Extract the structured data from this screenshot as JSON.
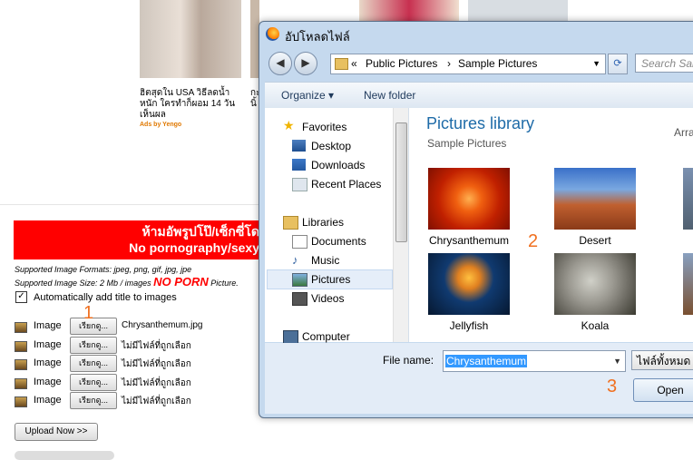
{
  "page": {
    "ads": [
      {
        "text": "ฮิตสุดใน USA วิธีลดน้ำหนัก ใครทำก็ผอม 14 วัน เห็นผล",
        "by": "Ads by Yengo"
      },
      {
        "text": "กะ นิ้"
      }
    ],
    "banner": {
      "line1": "ห้ามอัพรูปโป๊/เซ็กซี่โด",
      "line2": "No pornography/sexy"
    },
    "supported_formats": "Supported Image Formats: jpeg, png, gif, jpg, jpe",
    "supported_size": "Supported Image Size: 2 Mb / images",
    "no_porn": "NO PORN",
    "picture_word": "Picture.",
    "auto_title_checked": true,
    "auto_title_label": "Automatically add title to images",
    "image_rows": [
      {
        "label": "Image",
        "button": "เรียกดู...",
        "file": "Chrysanthemum.jpg"
      },
      {
        "label": "Image",
        "button": "เรียกดู...",
        "file": "ไม่มีไฟล์ที่ถูกเลือก"
      },
      {
        "label": "Image",
        "button": "เรียกดู...",
        "file": "ไม่มีไฟล์ที่ถูกเลือก"
      },
      {
        "label": "Image",
        "button": "เรียกดู...",
        "file": "ไม่มีไฟล์ที่ถูกเลือก"
      },
      {
        "label": "Image",
        "button": "เรียกดู...",
        "file": "ไม่มีไฟล์ที่ถูกเลือก"
      }
    ],
    "upload_button": "Upload Now >>"
  },
  "annotations": {
    "one": "1",
    "two": "2",
    "three": "3"
  },
  "dialog": {
    "title": "อัปโหลดไฟล์",
    "breadcrumb": [
      "«",
      "Public Pictures",
      "›",
      "Sample Pictures"
    ],
    "search_placeholder": "Search Sam",
    "toolbar": {
      "organize": "Organize ▾",
      "new_folder": "New folder"
    },
    "nav": {
      "favorites": "Favorites",
      "desktop": "Desktop",
      "downloads": "Downloads",
      "recent_places": "Recent Places",
      "libraries": "Libraries",
      "documents": "Documents",
      "music": "Music",
      "pictures": "Pictures",
      "videos": "Videos",
      "computer": "Computer"
    },
    "library_title": "Pictures library",
    "library_subtitle": "Sample Pictures",
    "arrange_partial": "Arra",
    "files": [
      "Chrysanthemum",
      "Desert",
      "Jellyfish",
      "Koala"
    ],
    "file_name_label": "File name:",
    "file_name_value": "Chrysanthemum",
    "filter": "ไฟล์ทั้งหมด",
    "open_button": "Open"
  }
}
